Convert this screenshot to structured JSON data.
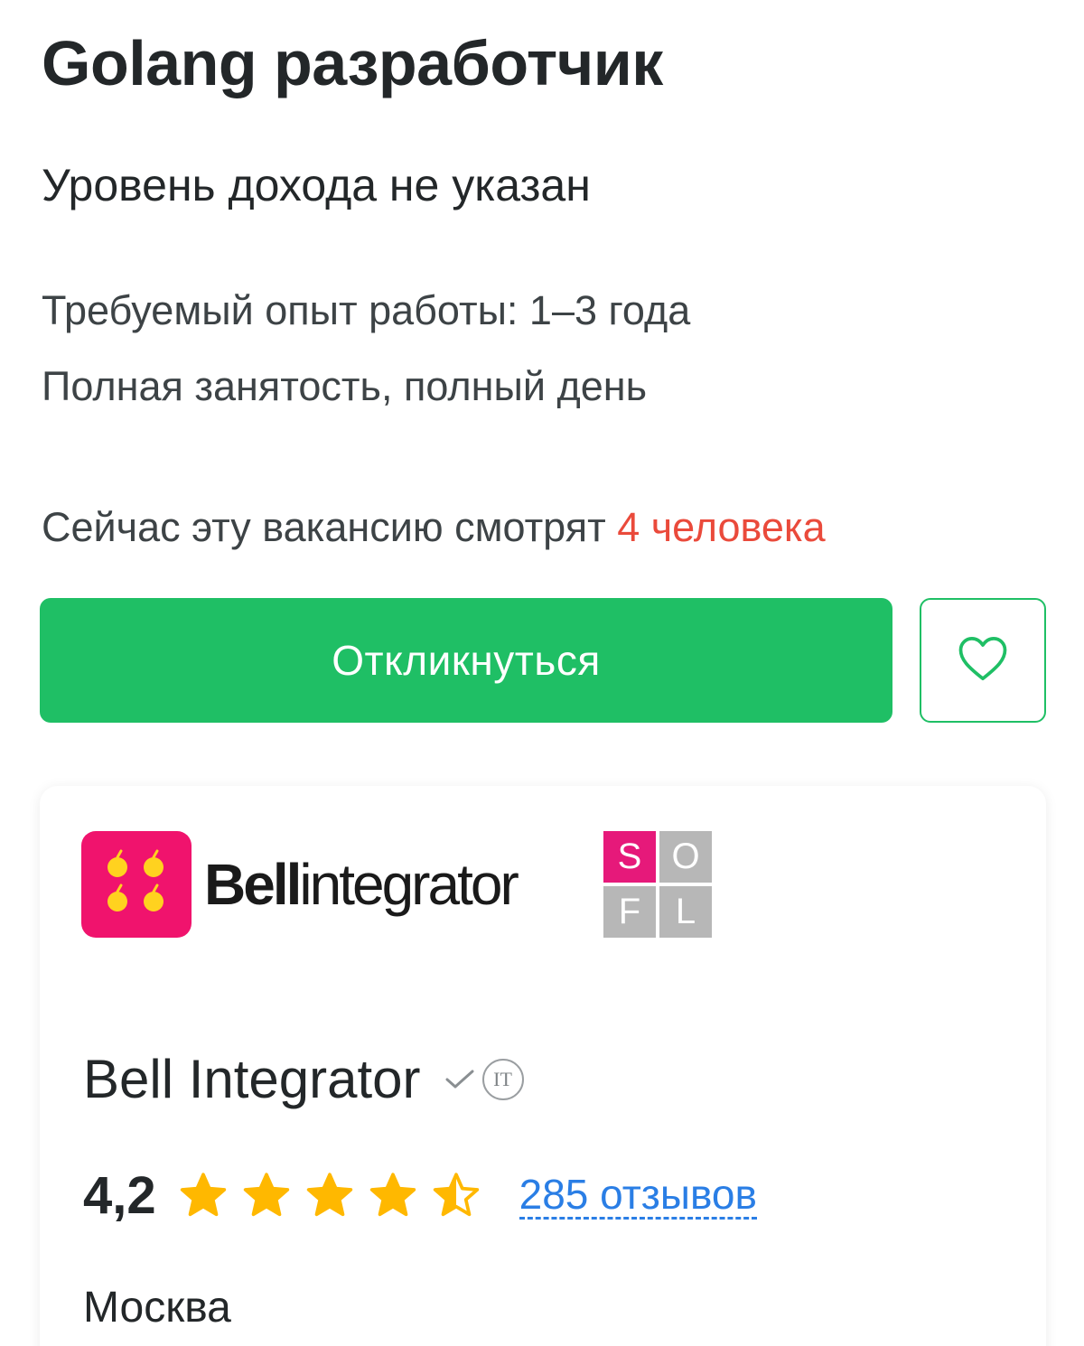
{
  "vacancy": {
    "title": "Golang разработчик",
    "salary": "Уровень дохода не указан",
    "experience": "Требуемый опыт работы: 1–3 года",
    "employment": "Полная занятость, полный день"
  },
  "viewers": {
    "prefix": "Сейчас эту вакансию смотрят ",
    "count_text": "4 человека"
  },
  "actions": {
    "apply_label": "Откликнуться",
    "favorite_icon": "heart-icon"
  },
  "colors": {
    "primary_green": "#1fbf65",
    "accent_red": "#ea4a3b",
    "link_blue": "#2a7ee5",
    "star_yellow": "#ffb800",
    "logo_pink": "#f0136d"
  },
  "employer": {
    "logo_text_bold": "Bell",
    "logo_text_light": "integrator",
    "badge_letters": [
      "S",
      "O",
      "F",
      "L"
    ],
    "name": "Bell Integrator",
    "verified_icon": "check-icon",
    "it_badge": "IT",
    "rating": "4,2",
    "rating_value": 4.2,
    "stars_max": 5,
    "reviews": "285 отзывов",
    "city": "Москва"
  }
}
